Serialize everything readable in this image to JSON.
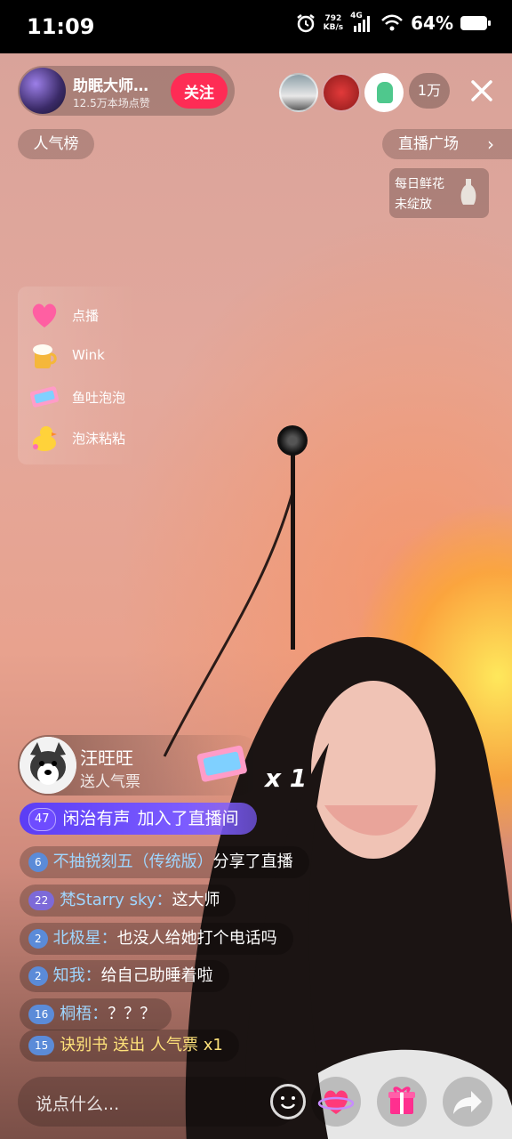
{
  "status": {
    "time": "11:09",
    "net_speed_top": "792",
    "net_speed_bottom": "KB/s",
    "signal_type": "4G",
    "battery": "64%"
  },
  "host": {
    "name": "助眠大师…",
    "likes": "12.5万本场点赞",
    "follow_label": "关注"
  },
  "viewers": {
    "count": "1万"
  },
  "top": {
    "popularity": "人气榜",
    "plaza": "直播广场"
  },
  "flower_card": {
    "line1": "每日鲜花",
    "line2": "未绽放"
  },
  "menu": [
    {
      "label": "点播",
      "icon": "heart-icon"
    },
    {
      "label": "Wink",
      "icon": "beer-icon"
    },
    {
      "label": "鱼吐泡泡",
      "icon": "ticket-icon"
    },
    {
      "label": "泡沫粘粘",
      "icon": "duck-icon"
    }
  ],
  "gift": {
    "user": "汪旺旺",
    "action": "送人气票",
    "count": "x 1"
  },
  "join": {
    "level": "47",
    "user": "闲治有声",
    "text": "加入了直播间"
  },
  "chat": [
    {
      "level": "6",
      "user": "不抽锐刻五（传统版）",
      "text": "分享了直播",
      "level_style": "blue",
      "name_style": "blue"
    },
    {
      "level": "22",
      "user": "梵Starry sky：",
      "text": "这大师",
      "level_style": "purple",
      "name_style": "blue"
    },
    {
      "level": "2",
      "user": "北极星：",
      "text": "也没人给她打个电话吗",
      "level_style": "blue",
      "name_style": "blue"
    },
    {
      "level": "2",
      "user": "知我：",
      "text": "给自己助睡着啦",
      "level_style": "blue",
      "name_style": "blue"
    },
    {
      "level": "16",
      "user": "桐梧：",
      "text": "？？？",
      "level_style": "blue",
      "name_style": "blue"
    },
    {
      "level": "15",
      "user": "诀别书",
      "text": "送出 人气票 x1",
      "level_style": "blue",
      "name_style": "yellow"
    }
  ],
  "input": {
    "placeholder": "说点什么..."
  },
  "colors": {
    "follow": "#fe2c55",
    "join_bg": "#6e4cff",
    "name_blue": "#9fd6ff",
    "name_yellow": "#ffe27a"
  }
}
